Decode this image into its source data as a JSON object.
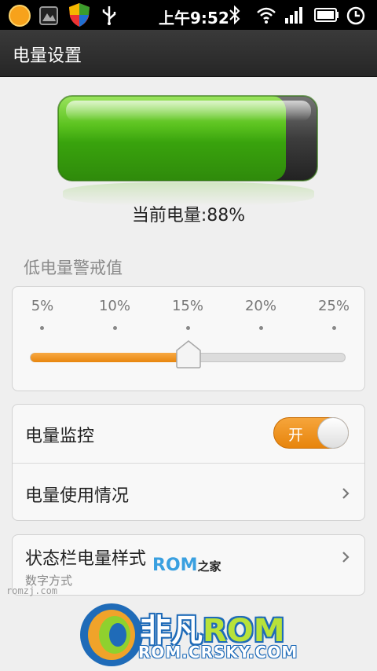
{
  "status_bar": {
    "time": "上午9:52",
    "icons": [
      "sun-icon",
      "image-icon",
      "shield-icon",
      "usb-icon",
      "bluetooth-icon",
      "wifi-icon",
      "signal-icon",
      "battery-icon",
      "alarm-icon"
    ]
  },
  "header": {
    "title": "电量设置"
  },
  "battery": {
    "level_text": "当前电量:88%",
    "level": 0.88,
    "fill_color": "#3cae12"
  },
  "low_battery": {
    "section_label": "低电量警戒值",
    "ticks": [
      "5%",
      "10%",
      "15%",
      "20%",
      "25%"
    ],
    "selected": "15%",
    "accent": "#f08f1a"
  },
  "settings": {
    "monitor": {
      "label": "电量监控",
      "toggle_text": "开",
      "on": true
    },
    "usage": {
      "label": "电量使用情况"
    },
    "statusbar_style": {
      "label": "状态栏电量样式",
      "value": "数字方式"
    }
  },
  "watermarks": {
    "small_brand": "ROM",
    "small_suffix": "之家",
    "romzj": "romzj.com",
    "big_prefix": "非凡",
    "big_rom": "ROM",
    "url": "ROM.CRSKY.COM"
  }
}
